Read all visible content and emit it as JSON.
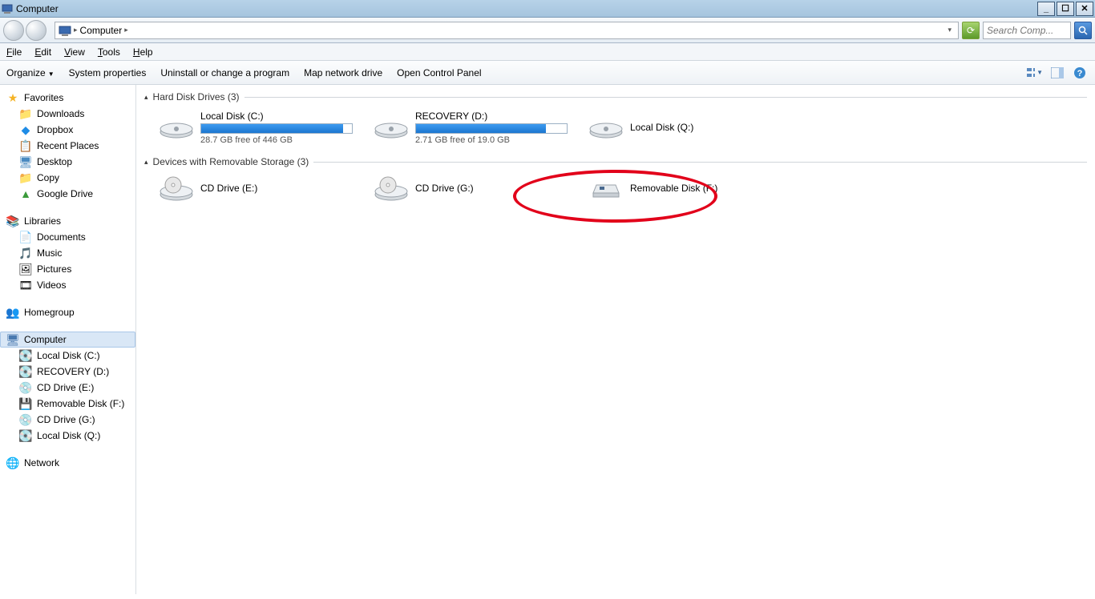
{
  "window": {
    "title": "Computer"
  },
  "address": {
    "location": "Computer"
  },
  "search": {
    "placeholder": "Search Comp..."
  },
  "menubar": {
    "file": "File",
    "edit": "Edit",
    "view": "View",
    "tools": "Tools",
    "help": "Help"
  },
  "cmdbar": {
    "organize": "Organize",
    "sysprops": "System properties",
    "uninstall": "Uninstall or change a program",
    "mapnet": "Map network drive",
    "ctrlpanel": "Open Control Panel"
  },
  "nav": {
    "favorites": {
      "label": "Favorites",
      "items": [
        "Downloads",
        "Dropbox",
        "Recent Places",
        "Desktop",
        "Copy",
        "Google Drive"
      ]
    },
    "libraries": {
      "label": "Libraries",
      "items": [
        "Documents",
        "Music",
        "Pictures",
        "Videos"
      ]
    },
    "homegroup": {
      "label": "Homegroup"
    },
    "computer": {
      "label": "Computer",
      "items": [
        "Local Disk (C:)",
        "RECOVERY (D:)",
        "CD Drive (E:)",
        "Removable Disk (F:)",
        "CD Drive (G:)",
        "Local Disk (Q:)"
      ]
    },
    "network": {
      "label": "Network"
    }
  },
  "groups": {
    "hdd": {
      "title": "Hard Disk Drives (3)"
    },
    "removable": {
      "title": "Devices with Removable Storage (3)"
    }
  },
  "drives": {
    "c": {
      "name": "Local Disk (C:)",
      "free": "28.7 GB free of 446 GB",
      "fill_pct": 94
    },
    "d": {
      "name": "RECOVERY (D:)",
      "free": "2.71 GB free of 19.0 GB",
      "fill_pct": 86
    },
    "q": {
      "name": "Local Disk (Q:)"
    },
    "e": {
      "name": "CD Drive (E:)"
    },
    "g": {
      "name": "CD Drive (G:)"
    },
    "f": {
      "name": "Removable Disk (F:)"
    }
  }
}
